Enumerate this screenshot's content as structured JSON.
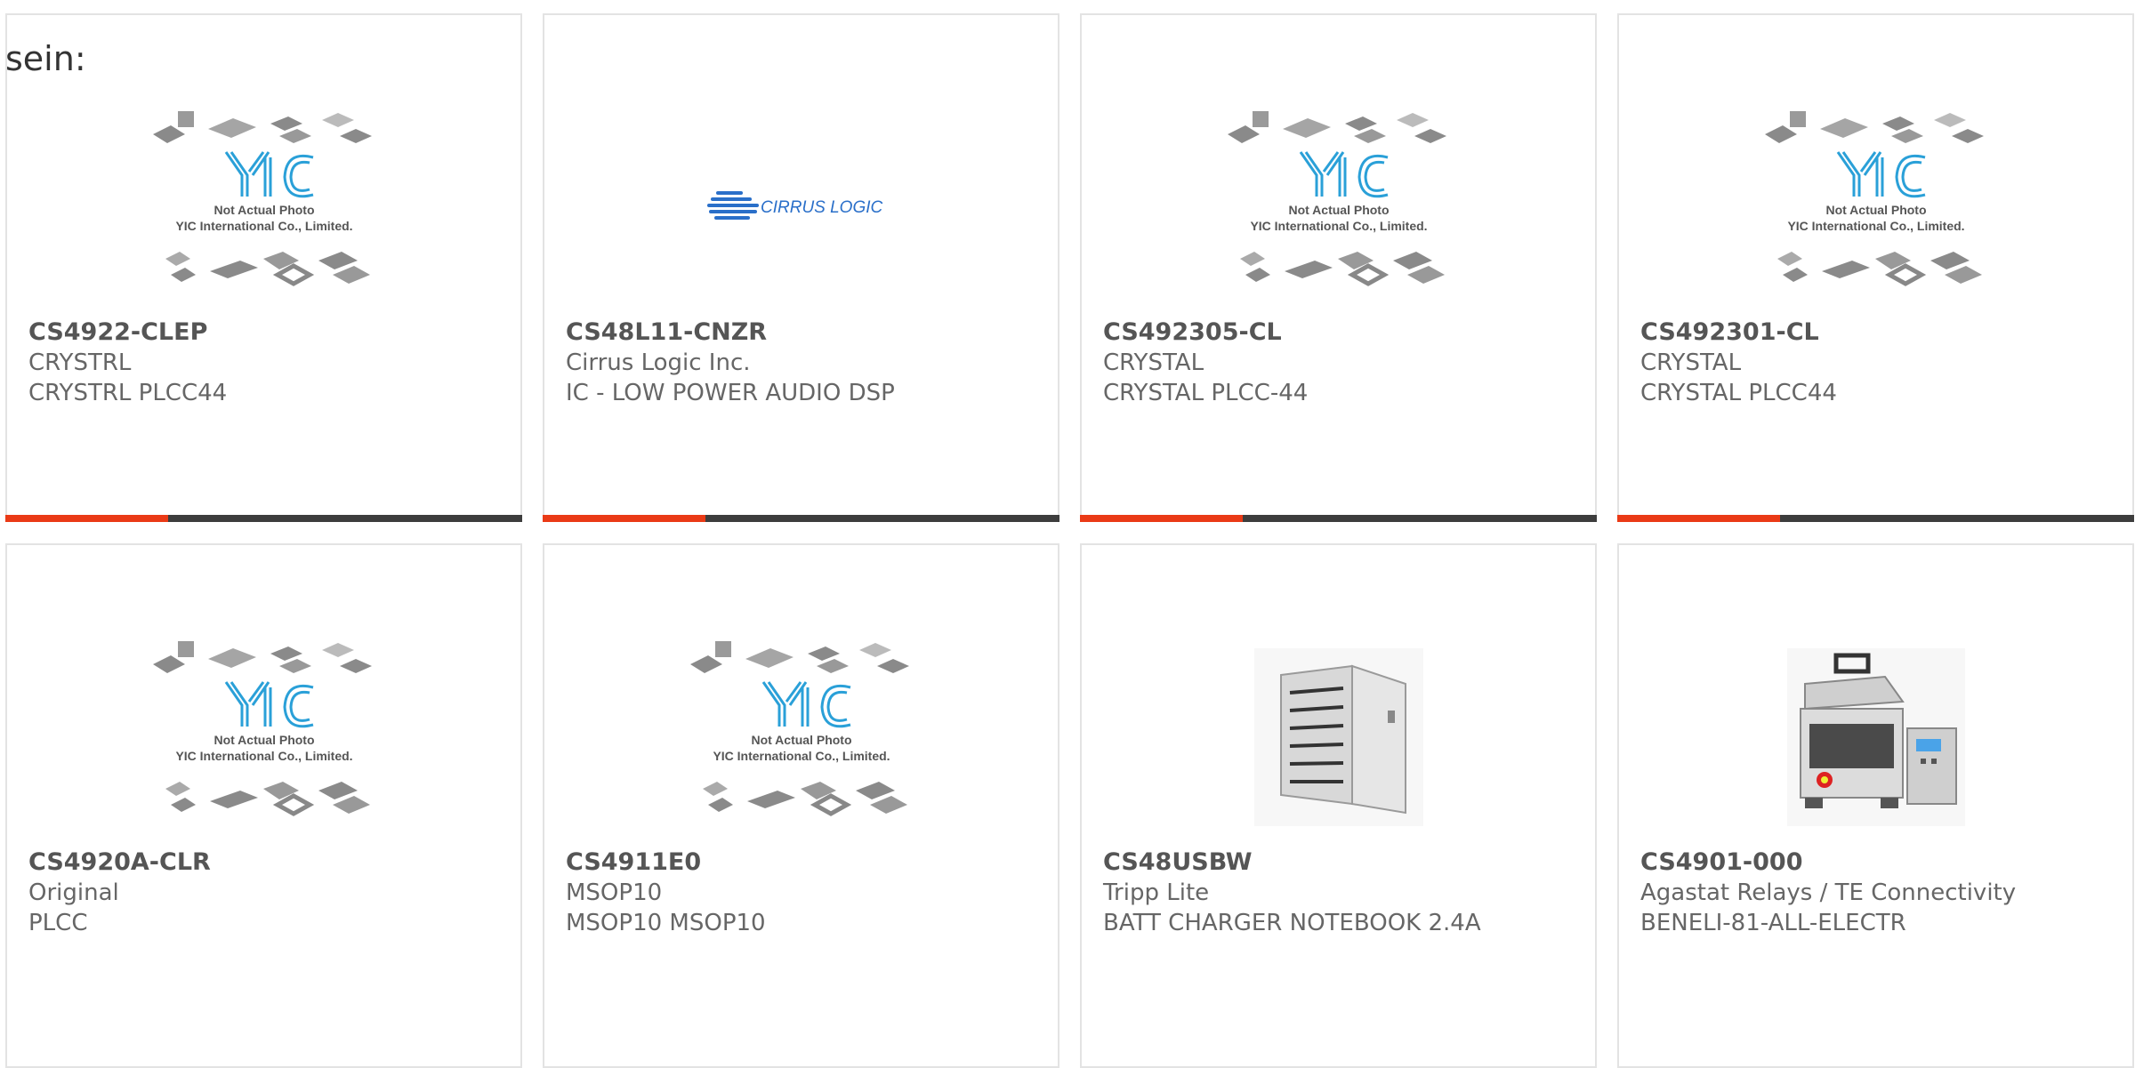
{
  "intro_text": "sein:",
  "colors": {
    "accent": "#ea3a16",
    "bar": "#3d3d3d",
    "logo_blue": "#2aa0d8"
  },
  "placeholder": {
    "logo": "YIC",
    "line1": "Not Actual Photo",
    "line2": "YIC International Co., Limited."
  },
  "cirrus_logo_text": "CIRRUS LOGIC",
  "products": [
    {
      "pn": "CS4922-CLEP",
      "maker": "CRYSTRL",
      "desc": "CRYSTRL PLCC44",
      "image": "placeholder"
    },
    {
      "pn": "CS48L11-CNZR",
      "maker": "Cirrus Logic Inc.",
      "desc": "IC - LOW POWER AUDIO DSP",
      "image": "cirrus-logo"
    },
    {
      "pn": "CS492305-CL",
      "maker": "CRYSTAL",
      "desc": "CRYSTAL PLCC-44",
      "image": "placeholder"
    },
    {
      "pn": "CS492301-CL",
      "maker": "CRYSTAL",
      "desc": "CRYSTAL PLCC44",
      "image": "placeholder"
    },
    {
      "pn": "CS4920A-CLR",
      "maker": "Original",
      "desc": "PLCC",
      "image": "placeholder"
    },
    {
      "pn": "CS4911E0",
      "maker": "MSOP10",
      "desc": "MSOP10 MSOP10",
      "image": "placeholder"
    },
    {
      "pn": "CS48USBW",
      "maker": "Tripp Lite",
      "desc": "BATT CHARGER NOTEBOOK 2.4A",
      "image": "cabinet-photo"
    },
    {
      "pn": "CS4901-000",
      "maker": "Agastat Relays / TE Connectivity",
      "desc": "BENELI-81-ALL-ELECTR",
      "image": "machine-photo"
    }
  ]
}
